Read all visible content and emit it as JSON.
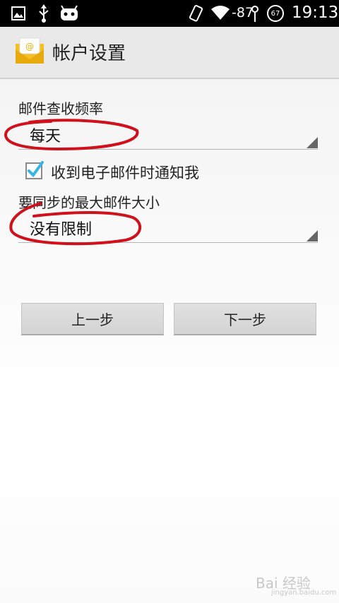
{
  "status_bar": {
    "icons": [
      "image-icon",
      "usb-icon",
      "cyanogenmod-icon",
      "vibrate-icon",
      "wifi-icon",
      "signal-icon",
      "battery-icon"
    ],
    "signal_strength": "-87",
    "battery_level": "67",
    "time": "19:13"
  },
  "app_bar": {
    "icon": "email-icon",
    "title": "帐户设置"
  },
  "form": {
    "check_frequency": {
      "label": "邮件查收频率",
      "value": "每天"
    },
    "notify_checkbox": {
      "label": "收到电子邮件时通知我",
      "checked": true
    },
    "max_size": {
      "label": "要同步的最大邮件大小",
      "value": "没有限制"
    }
  },
  "buttons": {
    "previous": "上一步",
    "next": "下一步"
  },
  "annotation_color": "#d0101a",
  "accent_color": "#33b5e5",
  "watermark": {
    "text": "Bai 经验",
    "url": "jingyan.baidu.com"
  }
}
